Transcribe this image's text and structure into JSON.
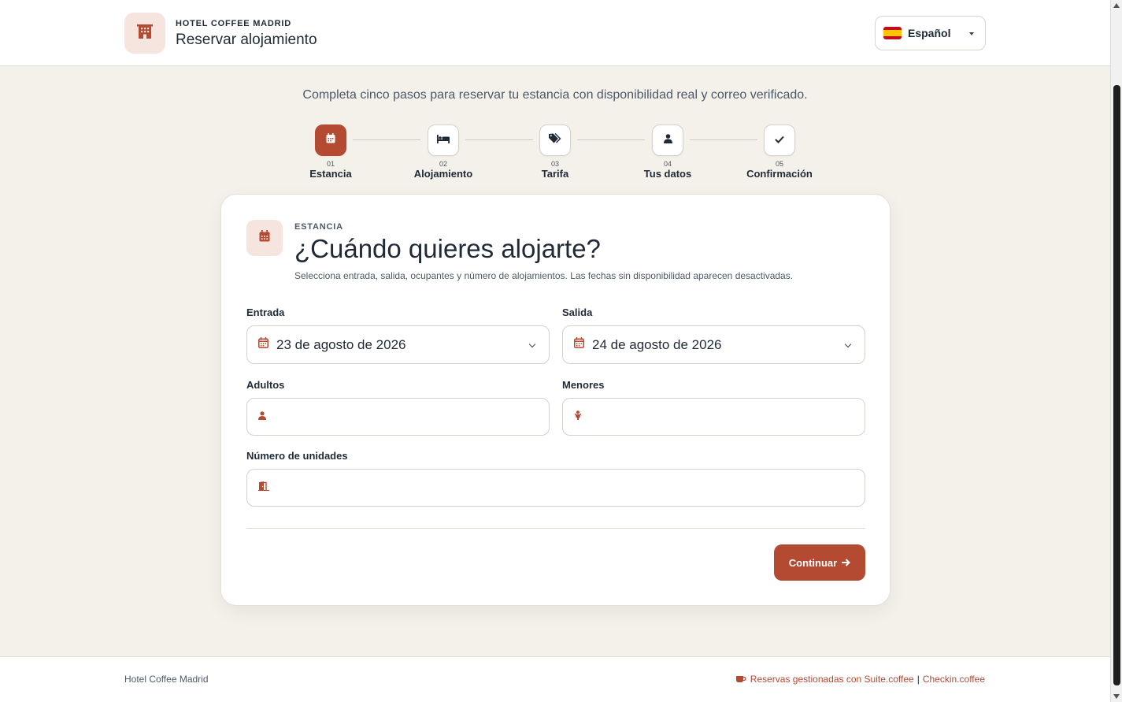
{
  "header": {
    "brand_small": "HOTEL COFFEE MADRID",
    "title": "Reservar alojamiento",
    "language": "Español"
  },
  "hero": {
    "title": "Hotel Coffee Madrid",
    "subtitle": "Completa cinco pasos para reservar tu estancia con disponibilidad real y correo verificado."
  },
  "steps": [
    {
      "num": "01",
      "label": "Estancia",
      "icon": "calendar-icon"
    },
    {
      "num": "02",
      "label": "Alojamiento",
      "icon": "bed-icon"
    },
    {
      "num": "03",
      "label": "Tarifa",
      "icon": "tags-icon"
    },
    {
      "num": "04",
      "label": "Tus datos",
      "icon": "user-icon"
    },
    {
      "num": "05",
      "label": "Confirmación",
      "icon": "check-icon"
    }
  ],
  "card": {
    "eyebrow": "ESTANCIA",
    "title": "¿Cuándo quieres alojarte?",
    "description": "Selecciona entrada, salida, ocupantes y número de alojamientos. Las fechas sin disponibilidad aparecen desactivadas.",
    "checkin_label": "Entrada",
    "checkin_value": "23 de agosto de 2026",
    "checkout_label": "Salida",
    "checkout_value": "24 de agosto de 2026",
    "adults_label": "Adultos",
    "children_label": "Menores",
    "units_label": "Número de unidades",
    "continue_label": "Continuar"
  },
  "footer": {
    "left": "Hotel Coffee Madrid",
    "right_prefix": "Reservas gestionadas con ",
    "link1": "Suite.coffee",
    "separator": "|",
    "link2": "Checkin.coffee"
  },
  "colors": {
    "accent": "#b34a31",
    "accent_soft": "#f6e5df",
    "background": "#f4f0ea",
    "text": "#1f2a36"
  }
}
